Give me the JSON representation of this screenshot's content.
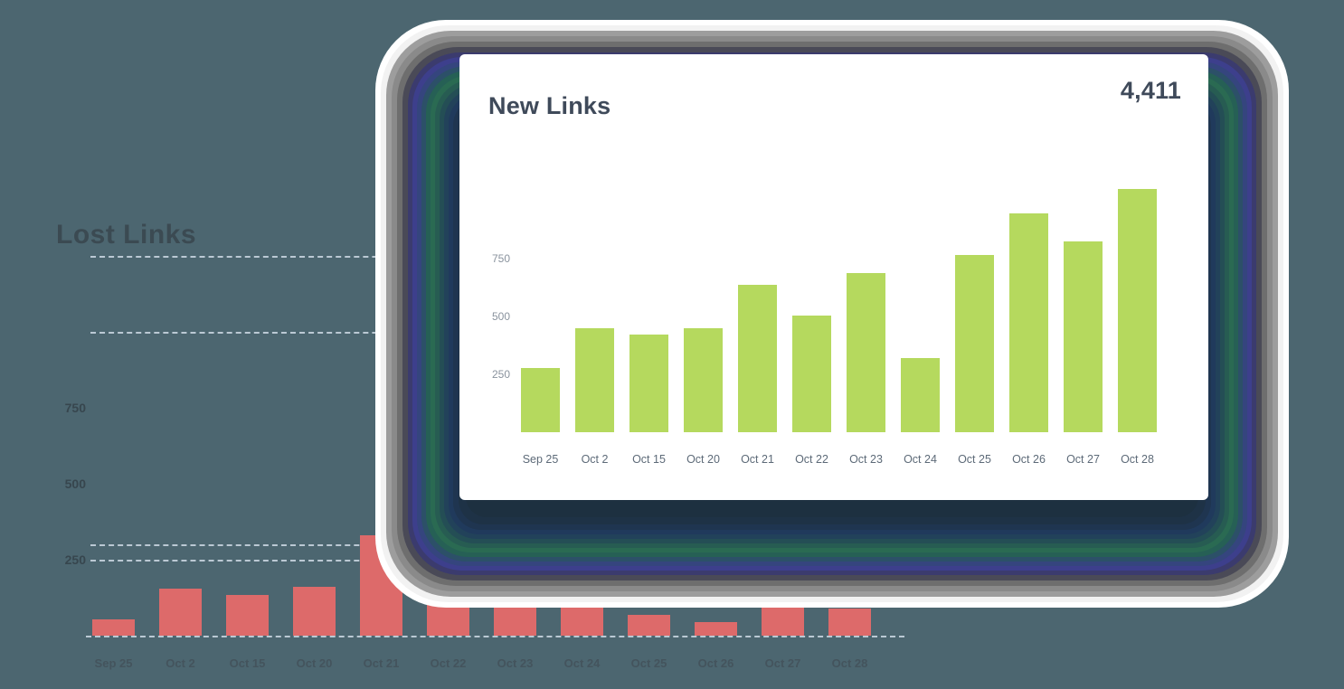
{
  "colors": {
    "background_teal": "#4c6670",
    "lost_bar": "#dd6a6a",
    "new_bar": "#b5d95e",
    "card_background": "#ffffff",
    "text_dark": "#3f4a5a",
    "gridline": "#cfdbe6"
  },
  "lost_panel": {
    "title": "Lost Links"
  },
  "new_card": {
    "title": "New Links",
    "total_value": "4,411"
  },
  "chart_data": [
    {
      "type": "bar",
      "title": "Lost Links",
      "xlabel": "",
      "ylabel": "",
      "categories": [
        "Sep 25",
        "Oct 2",
        "Oct 15",
        "Oct 20",
        "Oct 21",
        "Oct 22",
        "Oct 23",
        "Oct 24",
        "Oct 25",
        "Oct 26",
        "Oct 27",
        "Oct 28"
      ],
      "values": [
        54,
        155,
        134,
        161,
        330,
        202,
        327,
        274,
        69,
        45,
        131,
        89
      ],
      "ytick_labels": [
        "250",
        "500",
        "750"
      ],
      "yticks": [
        250,
        500,
        750
      ],
      "ylim": [
        0,
        1500
      ],
      "grid": true,
      "gridline_values": [
        250,
        300,
        1000,
        1250
      ],
      "legend": "none",
      "bar_color": "#dd6a6a",
      "background": "#4c6670"
    },
    {
      "type": "bar",
      "title": "New Links",
      "subtitle": "4,411",
      "xlabel": "",
      "ylabel": "",
      "categories": [
        "Sep 25",
        "Oct 2",
        "Oct 15",
        "Oct 20",
        "Oct 21",
        "Oct 22",
        "Oct 23",
        "Oct 24",
        "Oct 25",
        "Oct 26",
        "Oct 27",
        "Oct 28"
      ],
      "values": [
        277,
        450,
        422,
        450,
        637,
        504,
        687,
        320,
        766,
        945,
        824,
        1050
      ],
      "ytick_labels": [
        "250",
        "500",
        "750"
      ],
      "yticks": [
        250,
        500,
        750
      ],
      "ylim": [
        0,
        1120
      ],
      "grid": false,
      "legend": "none",
      "bar_color": "#b5d95e",
      "background": "#ffffff"
    }
  ],
  "glow_rings": [
    {
      "color": "#ffffff",
      "inset": 0
    },
    {
      "color": "#f2f2f2",
      "inset": 6
    },
    {
      "color": "#9d9d9d",
      "inset": 12
    },
    {
      "color": "#8a8a8a",
      "inset": 18
    },
    {
      "color": "#6e6e6e",
      "inset": 24
    },
    {
      "color": "#4a4a57",
      "inset": 30
    },
    {
      "color": "#3b3b6e",
      "inset": 36
    },
    {
      "color": "#3d3f8c",
      "inset": 41
    },
    {
      "color": "#35457e",
      "inset": 46
    },
    {
      "color": "#2c5068",
      "inset": 51
    },
    {
      "color": "#266055",
      "inset": 56
    },
    {
      "color": "#2a6a52",
      "inset": 61
    },
    {
      "color": "#275c52",
      "inset": 66
    },
    {
      "color": "#244e55",
      "inset": 71
    },
    {
      "color": "#22425a",
      "inset": 76
    },
    {
      "color": "#203a5c",
      "inset": 81
    },
    {
      "color": "#1f3550",
      "inset": 86
    },
    {
      "color": "#1e3246",
      "inset": 92
    },
    {
      "color": "#1d3040",
      "inset": 100
    }
  ]
}
